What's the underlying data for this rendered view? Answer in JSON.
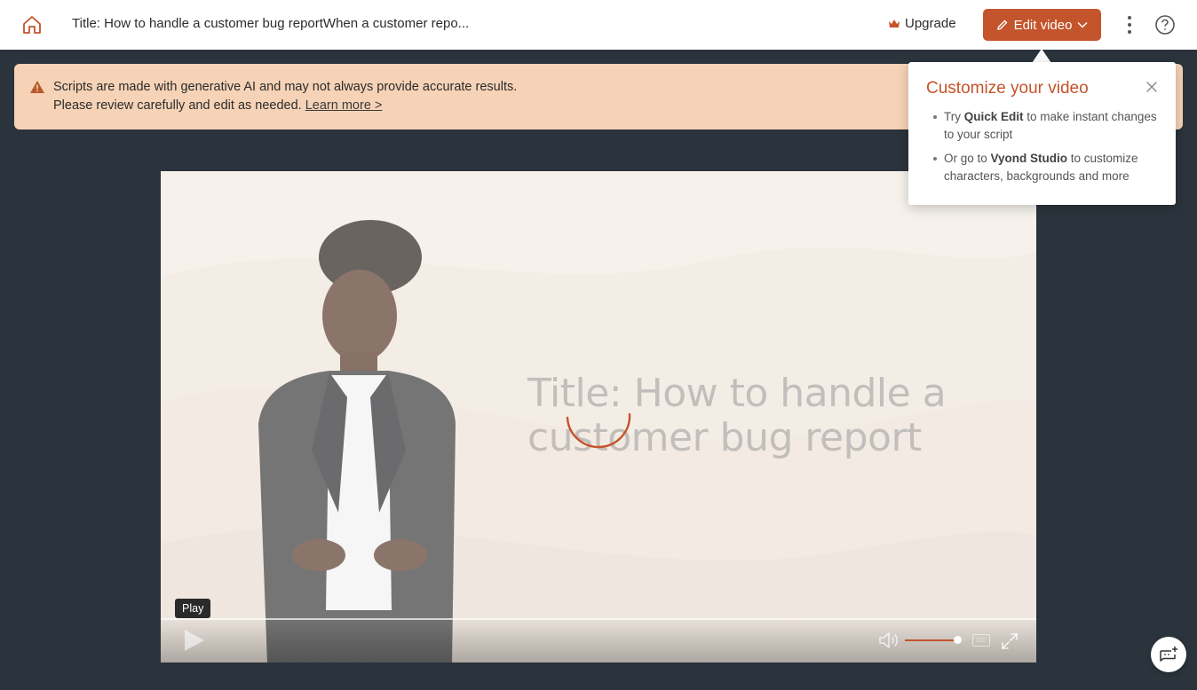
{
  "header": {
    "title": "Title: How to handle a customer bug reportWhen a customer repo...",
    "upgrade_label": "Upgrade",
    "edit_label": "Edit video"
  },
  "banner": {
    "line1": "Scripts are made with generative AI and may not always provide accurate results.",
    "line2": "Please review carefully and edit as needed.",
    "link": "Learn more >"
  },
  "player": {
    "slide_title": "Title: How to handle a customer bug report",
    "tooltip": "Play",
    "cc_label": "CC",
    "volume": 0.92
  },
  "popover": {
    "title": "Customize your video",
    "items": [
      {
        "pre": "Try ",
        "bold": "Quick Edit",
        "post": " to make instant changes to your script"
      },
      {
        "pre": "Or go to ",
        "bold": "Vyond Studio",
        "post": " to customize characters, backgrounds and more"
      }
    ]
  },
  "colors": {
    "accent": "#c4542b",
    "banner_bg": "#f6d3b7",
    "page_bg": "#2b333c"
  },
  "icons": {
    "home": "home-icon",
    "upgrade": "crown-icon",
    "edit": "pencil-icon",
    "more": "kebab-icon",
    "help": "help-icon",
    "warning": "warning-icon",
    "close": "close-icon",
    "chat": "chat-bot-icon"
  }
}
